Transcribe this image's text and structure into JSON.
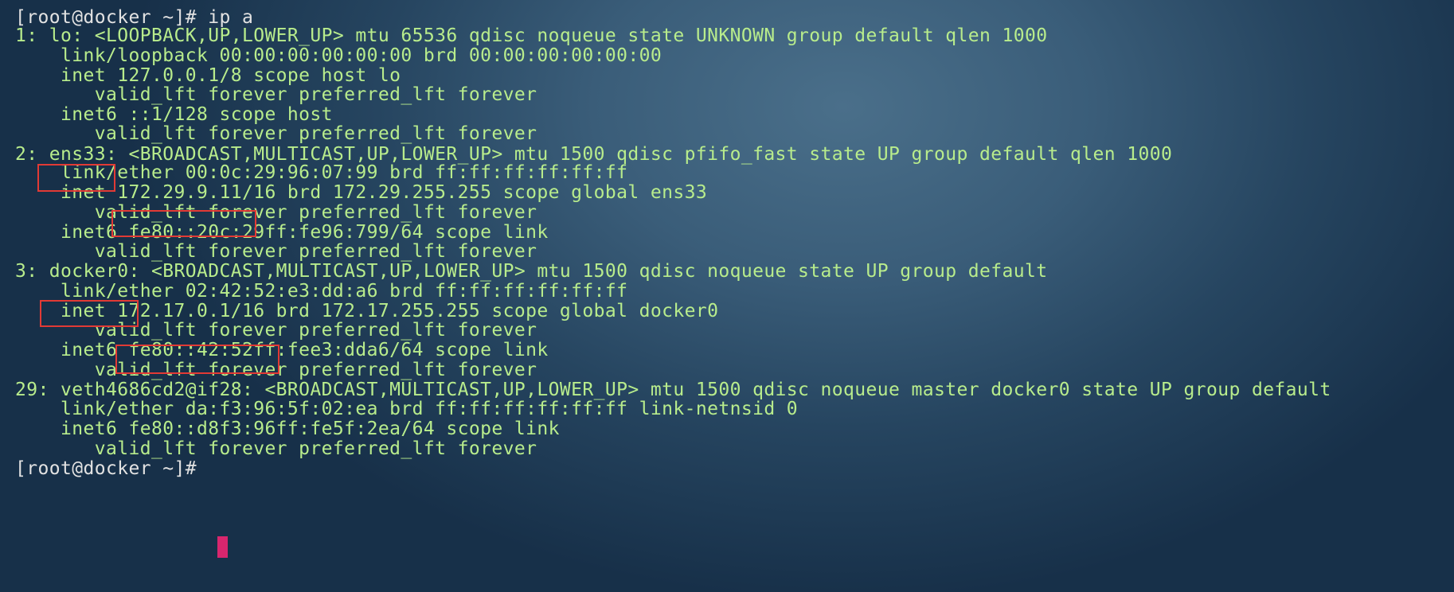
{
  "terminal": {
    "lines": [
      "[root@docker ~]# ip a",
      "1: lo: <LOOPBACK,UP,LOWER_UP> mtu 65536 qdisc noqueue state UNKNOWN group default qlen 1000",
      "    link/loopback 00:00:00:00:00:00 brd 00:00:00:00:00:00",
      "    inet 127.0.0.1/8 scope host lo",
      "       valid_lft forever preferred_lft forever",
      "    inet6 ::1/128 scope host",
      "       valid_lft forever preferred_lft forever",
      "2: ens33: <BROADCAST,MULTICAST,UP,LOWER_UP> mtu 1500 qdisc pfifo_fast state UP group default qlen 1000",
      "    link/ether 00:0c:29:96:07:99 brd ff:ff:ff:ff:ff:ff",
      "    inet 172.29.9.11/16 brd 172.29.255.255 scope global ens33",
      "       valid_lft forever preferred_lft forever",
      "    inet6 fe80::20c:29ff:fe96:799/64 scope link",
      "       valid_lft forever preferred_lft forever",
      "3: docker0: <BROADCAST,MULTICAST,UP,LOWER_UP> mtu 1500 qdisc noqueue state UP group default",
      "    link/ether 02:42:52:e3:dd:a6 brd ff:ff:ff:ff:ff:ff",
      "    inet 172.17.0.1/16 brd 172.17.255.255 scope global docker0",
      "       valid_lft forever preferred_lft forever",
      "    inet6 fe80::42:52ff:fee3:dda6/64 scope link",
      "       valid_lft forever preferred_lft forever",
      "29: veth4686cd2@if28: <BROADCAST,MULTICAST,UP,LOWER_UP> mtu 1500 qdisc noqueue master docker0 state UP group default",
      "    link/ether da:f3:96:5f:02:ea brd ff:ff:ff:ff:ff:ff link-netnsid 0",
      "    inet6 fe80::d8f3:96ff:fe5f:2ea/64 scope link",
      "       valid_lft forever preferred_lft forever",
      "[root@docker ~]# "
    ],
    "highlights": [
      "ens33",
      "172.29.9.11",
      "docker0",
      "172.17.0.1/16"
    ]
  },
  "colors": {
    "text": "#b8ec8c",
    "prompt": "#e2e2e2",
    "highlight_border": "#e23a35",
    "cursor": "#d8266e",
    "background": "#2d4d69"
  }
}
